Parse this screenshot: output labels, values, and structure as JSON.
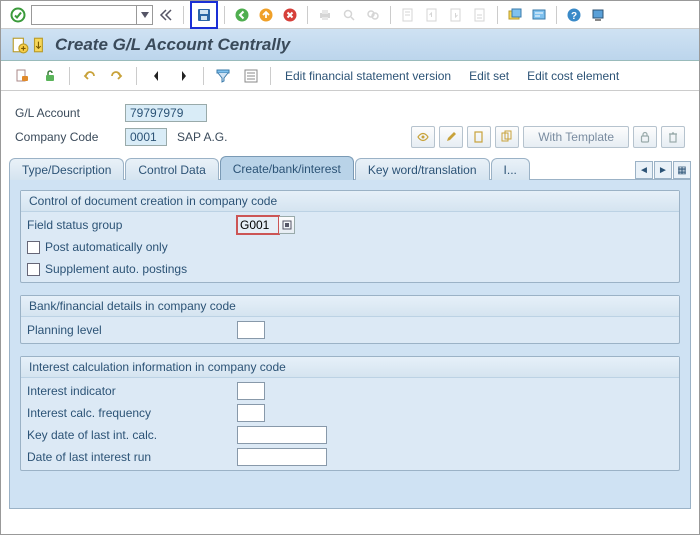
{
  "title": "Create G/L Account Centrally",
  "toolbar_links": {
    "fin_stmt": "Edit financial statement version",
    "edit_set": "Edit set",
    "edit_cost": "Edit cost element"
  },
  "header": {
    "gl_label": "G/L Account",
    "gl_value": "79797979",
    "cc_label": "Company Code",
    "cc_value": "0001",
    "cc_name": "SAP A.G.",
    "with_template": "With Template"
  },
  "tabs": {
    "t1": "Type/Description",
    "t2": "Control Data",
    "t3": "Create/bank/interest",
    "t4": "Key word/translation",
    "t5": "I..."
  },
  "group1": {
    "title": "Control of document creation in company code",
    "fsg_label": "Field status group",
    "fsg_value": "G001",
    "post_auto": "Post automatically only",
    "supp_auto": "Supplement auto. postings"
  },
  "group2": {
    "title": "Bank/financial details in company code",
    "plan_label": "Planning level"
  },
  "group3": {
    "title": "Interest calculation information in company code",
    "ind_label": "Interest indicator",
    "freq_label": "Interest calc. frequency",
    "key_label": "Key date of last int. calc.",
    "date_label": "Date of last interest run"
  }
}
